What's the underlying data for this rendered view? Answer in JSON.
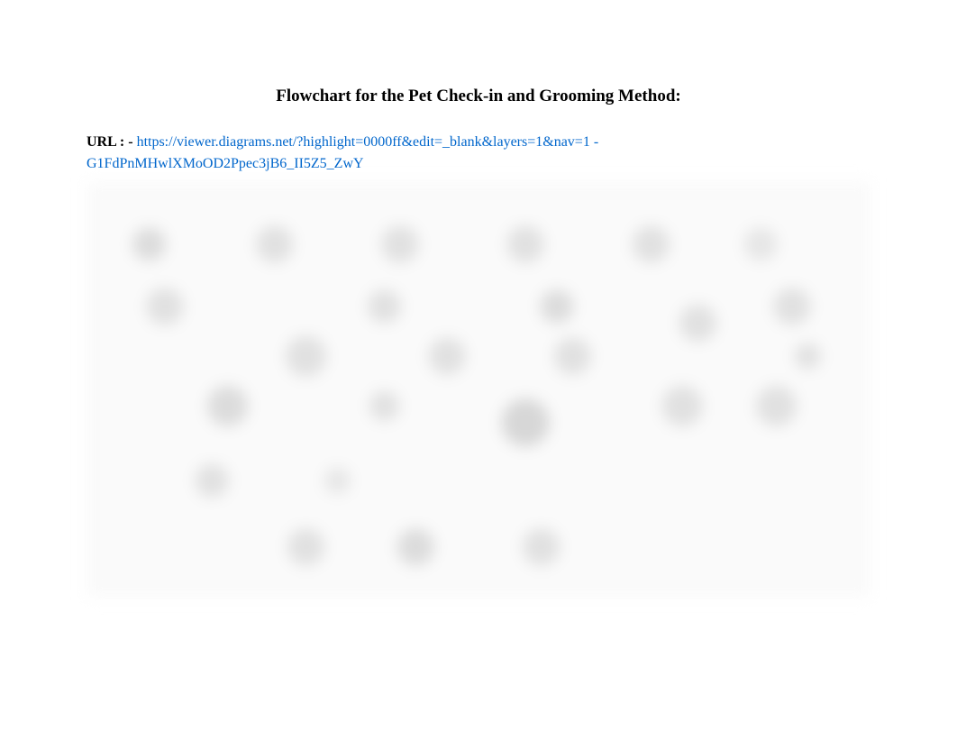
{
  "title": "Flowchart for the Pet Check-in and Grooming Method:",
  "url_label": "URL : - ",
  "url_text": "https://viewer.diagrams.net/?highlight=0000ff&edit=_blank&layers=1&nav=1 - G1FdPnMHwlXMoOD2Ppec3jB6_II5Z5_ZwY",
  "url_href": "https://viewer.diagrams.net/?highlight=0000ff&edit=_blank&layers=1&nav=1"
}
